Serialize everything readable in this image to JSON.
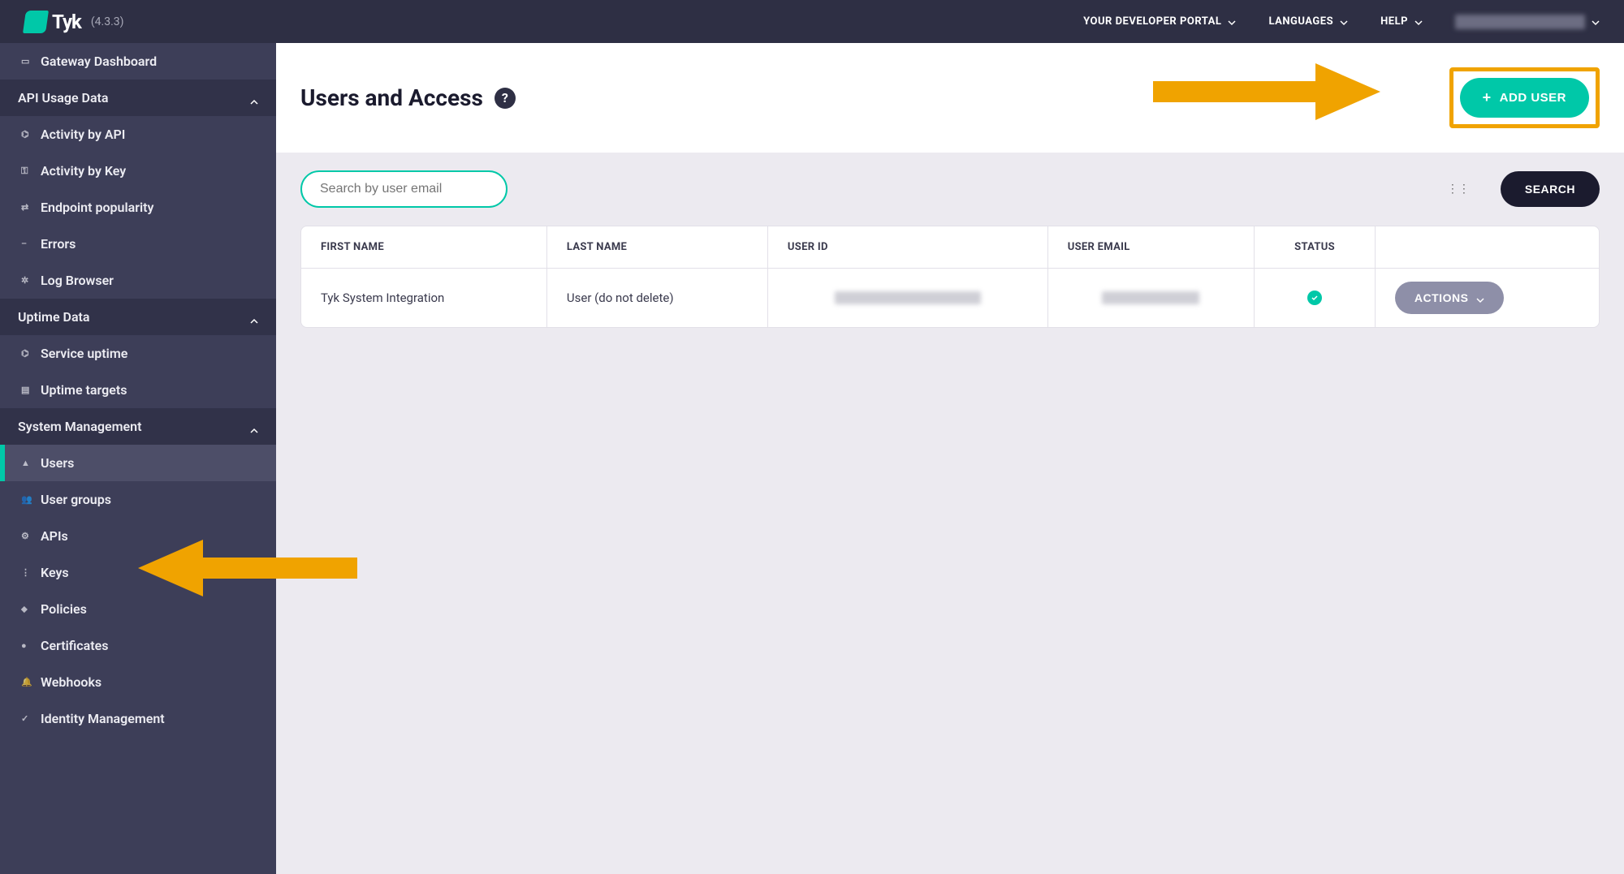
{
  "brand": {
    "name": "Tyk",
    "version": "(4.3.3)"
  },
  "topnav": {
    "portal": "YOUR DEVELOPER PORTAL",
    "languages": "LANGUAGES",
    "help": "HELP"
  },
  "sidebar": {
    "dashboard": "Gateway Dashboard",
    "groups": [
      {
        "label": "API Usage Data",
        "items": [
          {
            "icon": "speed-icon",
            "label": "Activity by API"
          },
          {
            "icon": "key-icon",
            "label": "Activity by Key"
          },
          {
            "icon": "shuffle-icon",
            "label": "Endpoint popularity"
          },
          {
            "icon": "minus-icon",
            "label": "Errors"
          },
          {
            "icon": "gear-icon",
            "label": "Log Browser"
          }
        ]
      },
      {
        "label": "Uptime Data",
        "items": [
          {
            "icon": "speed-icon",
            "label": "Service uptime"
          },
          {
            "icon": "list-icon",
            "label": "Uptime targets"
          }
        ]
      },
      {
        "label": "System Management",
        "items": [
          {
            "icon": "user-icon",
            "label": "Users",
            "active": true
          },
          {
            "icon": "users-icon",
            "label": "User groups"
          },
          {
            "icon": "gears-icon",
            "label": "APIs"
          },
          {
            "icon": "tree-icon",
            "label": "Keys"
          },
          {
            "icon": "bolt-icon",
            "label": "Policies"
          },
          {
            "icon": "dot-icon",
            "label": "Certificates"
          },
          {
            "icon": "bell-icon",
            "label": "Webhooks"
          },
          {
            "icon": "check-icon",
            "label": "Identity Management"
          }
        ]
      }
    ]
  },
  "page": {
    "title": "Users and Access",
    "add_user": "ADD USER",
    "search_placeholder": "Search by user email",
    "search_button": "SEARCH"
  },
  "table": {
    "columns": [
      "FIRST NAME",
      "LAST NAME",
      "USER ID",
      "USER EMAIL",
      "STATUS",
      ""
    ],
    "rows": [
      {
        "first": "Tyk System Integration",
        "last": "User (do not delete)",
        "actions": "ACTIONS"
      }
    ]
  },
  "colors": {
    "accent": "#00c8a8",
    "highlight": "#f0a300",
    "topbar": "#2e2f44",
    "sidebar": "#3d3e58"
  }
}
